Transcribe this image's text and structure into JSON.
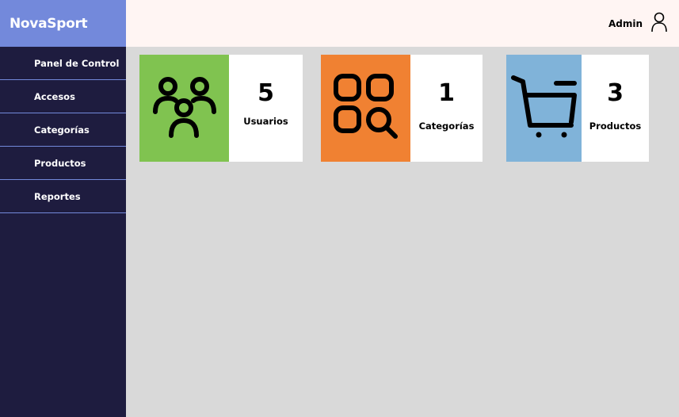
{
  "app": {
    "brand": "NovaSport"
  },
  "sidebar": {
    "items": [
      {
        "label": "Panel de Control"
      },
      {
        "label": "Accesos"
      },
      {
        "label": "Categorías"
      },
      {
        "label": "Productos"
      },
      {
        "label": "Reportes"
      }
    ]
  },
  "header": {
    "user_name": "Admin",
    "user_icon": "user-icon"
  },
  "cards": [
    {
      "count": "5",
      "label": "Usuarios",
      "icon": "users-icon",
      "color": "#80c350"
    },
    {
      "count": "1",
      "label": "Categorías",
      "icon": "category-search-icon",
      "color": "#f08132"
    },
    {
      "count": "3",
      "label": "Productos",
      "icon": "cart-icon",
      "color": "#80b3d9"
    }
  ],
  "colors": {
    "sidebar": "#1e1c3f",
    "brand_bg": "#7389db",
    "topbar": "#fff5f3",
    "content_bg": "#d9d9d9"
  }
}
